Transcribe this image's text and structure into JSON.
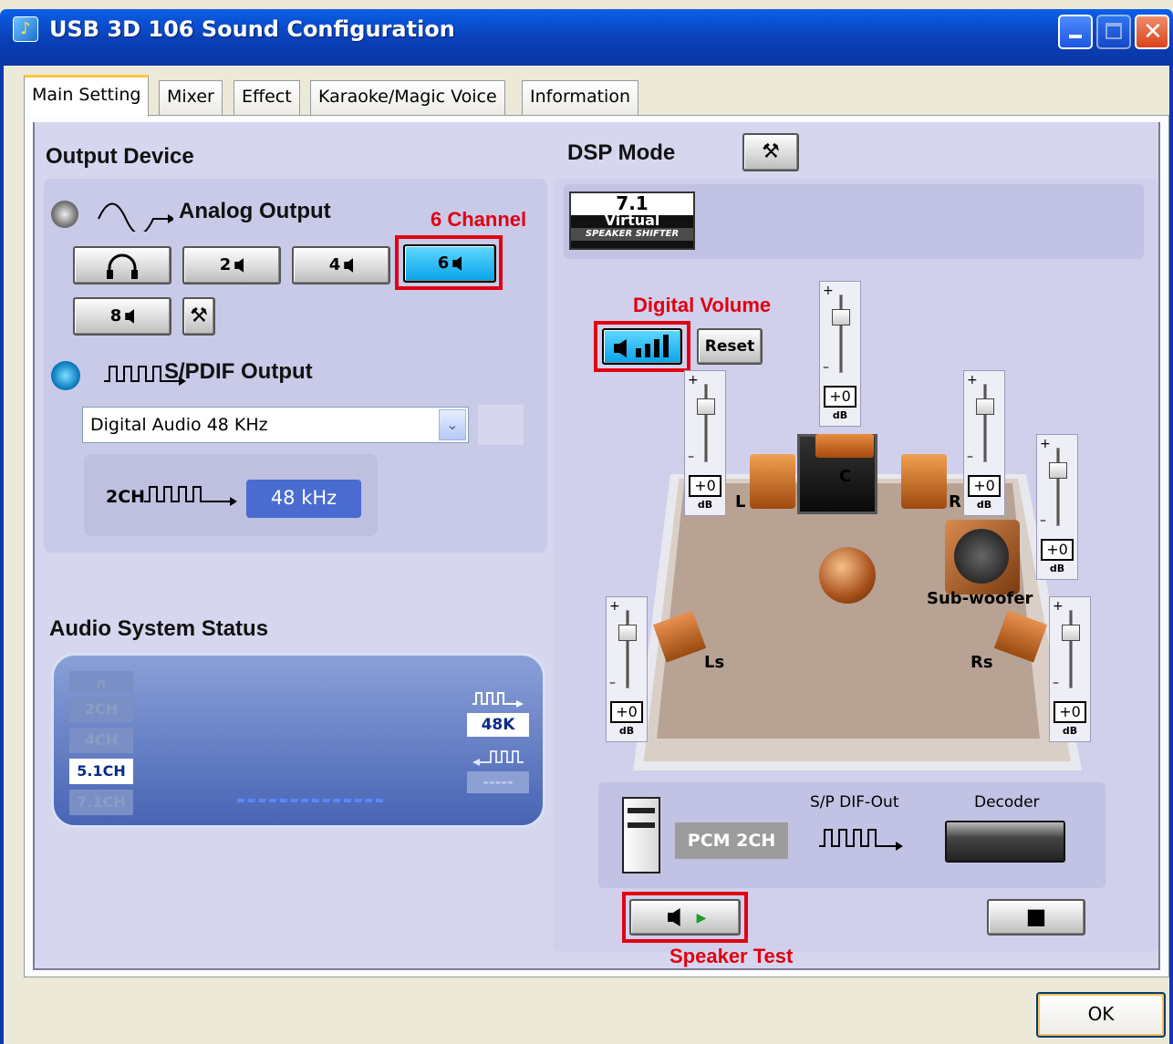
{
  "window": {
    "title": "USB 3D 106 Sound Configuration",
    "ok": "OK"
  },
  "tabs": [
    "Main Setting",
    "Mixer",
    "Effect",
    "Karaoke/Magic Voice",
    "Information"
  ],
  "output": {
    "heading": "Output Device",
    "analog": "Analog Output",
    "ch2": "2",
    "ch4": "4",
    "ch6": "6",
    "ch8": "8",
    "spdif": "S/PDIF Output",
    "spdif_select": "Digital Audio 48 KHz",
    "rate_label": "2CH",
    "rate_value": "48 kHz"
  },
  "annotations": {
    "six_channel": "6 Channel",
    "digital_volume": "Digital Volume",
    "speaker_test": "Speaker Test"
  },
  "dsp": {
    "heading": "DSP Mode",
    "badge_top": "7.1",
    "badge_mid": "Virtual",
    "badge_bot": "SPEAKER SHIFTER",
    "reset": "Reset"
  },
  "speakers": {
    "L": "L",
    "C": "C",
    "R": "R",
    "Ls": "Ls",
    "Rs": "Rs",
    "sub": "Sub-woofer"
  },
  "sliders": {
    "value": "+0",
    "unit": "dB",
    "plus": "+",
    "minus": "–"
  },
  "route": {
    "pcm": "PCM 2CH",
    "spdif_out": "S/P DIF-Out",
    "decoder": "Decoder"
  },
  "status": {
    "heading": "Audio System Status",
    "items": [
      "2CH",
      "4CH",
      "5.1CH",
      "7.1CH"
    ],
    "rate": "48K",
    "dash": "-----"
  }
}
